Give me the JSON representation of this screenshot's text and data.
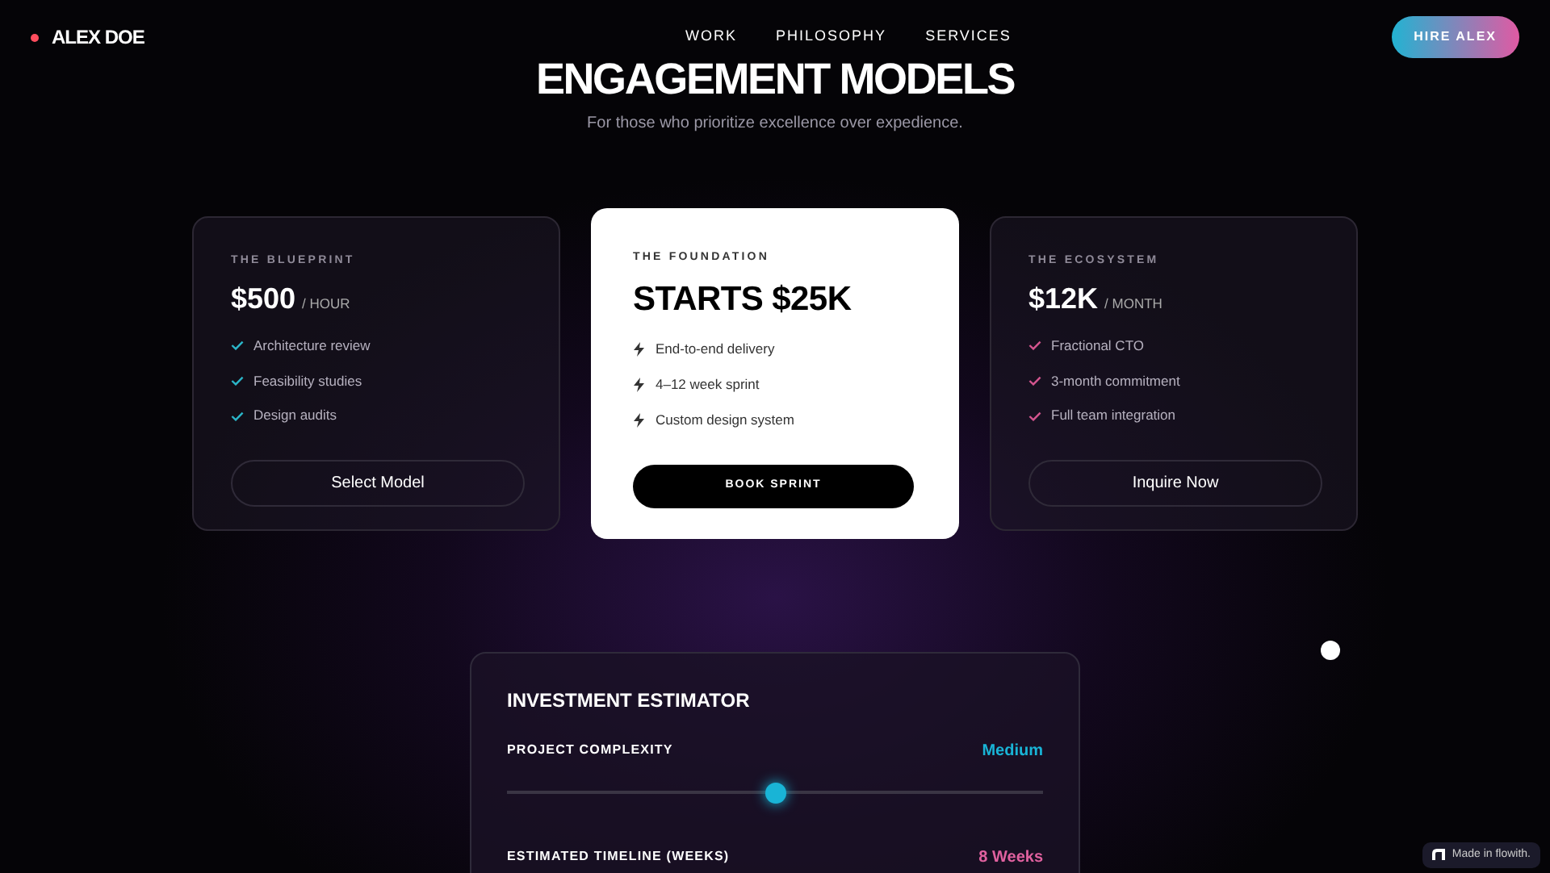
{
  "brand": {
    "name": "ALEX DOE"
  },
  "nav": [
    {
      "label": "WORK"
    },
    {
      "label": "PHILOSOPHY"
    },
    {
      "label": "SERVICES"
    }
  ],
  "cta": {
    "label": "HIRE ALEX"
  },
  "hero": {
    "title": "ENGAGEMENT MODELS",
    "subtitle": "For those who prioritize excellence over expedience."
  },
  "plans": [
    {
      "kind": "standard",
      "eyebrow": "THE BLUEPRINT",
      "price": "$500",
      "unit": "/ HOUR",
      "color": "#2bb6c9",
      "features": [
        "Architecture review",
        "Feasibility studies",
        "Design audits"
      ],
      "button": "Select Model"
    },
    {
      "kind": "featured",
      "eyebrow": "THE FOUNDATION",
      "price": "STARTS $25K",
      "features": [
        "End-to-end delivery",
        "4–12 week sprint",
        "Custom design system"
      ],
      "button": "BOOK SPRINT"
    },
    {
      "kind": "standard",
      "eyebrow": "THE ECOSYSTEM",
      "price": "$12K",
      "unit": "/ MONTH",
      "color": "#d5558f",
      "features": [
        "Fractional CTO",
        "3-month commitment",
        "Full team integration"
      ],
      "button": "Inquire Now"
    }
  ],
  "estimator": {
    "title": "INVESTMENT ESTIMATOR",
    "complexity": {
      "label": "PROJECT COMPLEXITY",
      "value": "Medium",
      "level": 0.5
    },
    "timeline": {
      "label": "ESTIMATED TIMELINE (WEEKS)",
      "value": "8 Weeks"
    }
  },
  "badge": {
    "label": "Made in flowith."
  }
}
